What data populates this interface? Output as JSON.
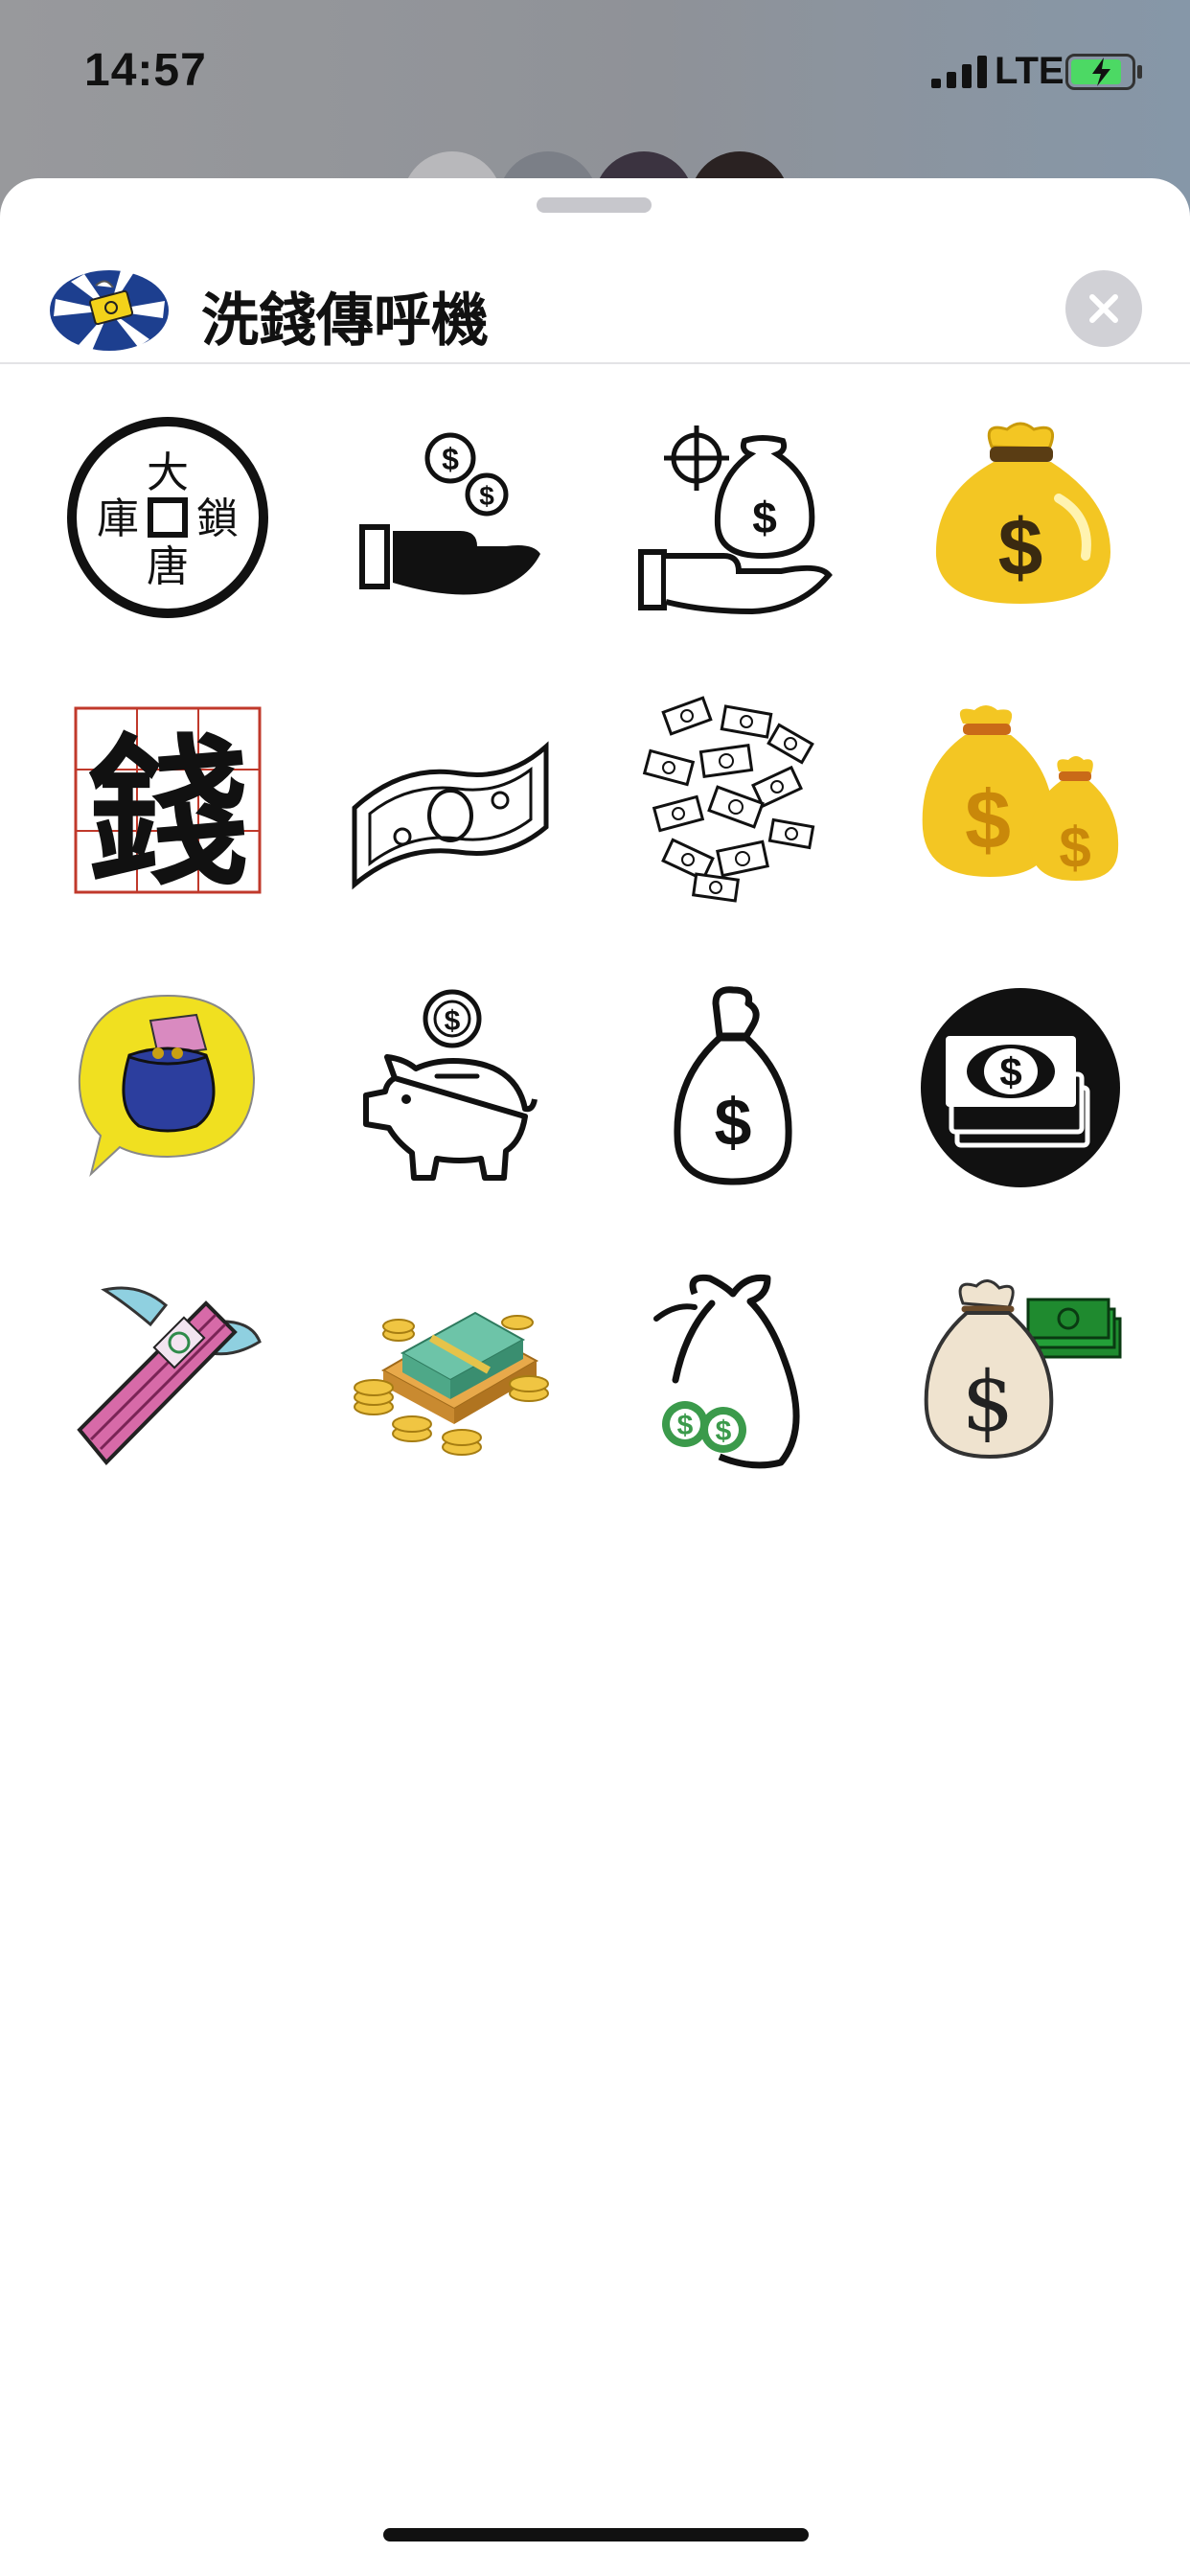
{
  "status_bar": {
    "time": "14:57",
    "network": "LTE"
  },
  "sheet": {
    "app_title": "洗錢傳呼機",
    "app_icon": "flying-money-logo-icon",
    "close_icon": "close-icon"
  },
  "stickers": [
    {
      "icon": "ancient-coin-sticker",
      "chars": [
        "大",
        "唐",
        "庫",
        "鎖"
      ]
    },
    {
      "icon": "hand-giving-coins-sticker"
    },
    {
      "icon": "hand-money-bag-target-sticker"
    },
    {
      "icon": "gold-money-bag-sticker"
    },
    {
      "icon": "qian-character-sticker",
      "char": "錢"
    },
    {
      "icon": "dollar-bill-sticker"
    },
    {
      "icon": "scattered-bills-sticker"
    },
    {
      "icon": "two-money-bags-sticker"
    },
    {
      "icon": "purse-money-bubble-sticker"
    },
    {
      "icon": "piggy-bank-sticker"
    },
    {
      "icon": "money-sack-outline-sticker"
    },
    {
      "icon": "cash-stack-circle-sticker"
    },
    {
      "icon": "flying-money-sticker"
    },
    {
      "icon": "cash-and-coins-pile-sticker"
    },
    {
      "icon": "bag-with-green-coins-sticker"
    },
    {
      "icon": "sack-and-banknotes-sticker"
    }
  ],
  "colors": {
    "gold": "#f3c623",
    "red_grid": "#c0392b",
    "green": "#3b9a4b",
    "dark_green": "#1f7a2f"
  }
}
